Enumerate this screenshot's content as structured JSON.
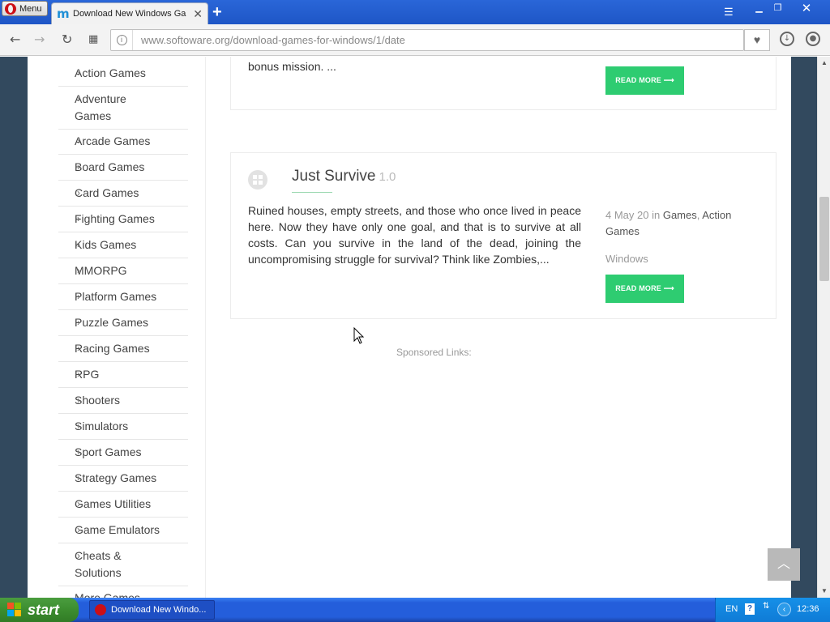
{
  "browser": {
    "menu_label": "Menu",
    "tab_title": "Download New Windows Games",
    "url": "www.softoware.org/download-games-for-windows/1/date"
  },
  "sidebar": {
    "categories": [
      {
        "label": "Action Games"
      },
      {
        "label": "Adventure Games"
      },
      {
        "label": "Arcade Games"
      },
      {
        "label": "Board Games"
      },
      {
        "label": "Card Games"
      },
      {
        "label": "Fighting Games"
      },
      {
        "label": "Kids Games"
      },
      {
        "label": "MMORPG"
      },
      {
        "label": "Platform Games"
      },
      {
        "label": "Puzzle Games"
      },
      {
        "label": "Racing Games"
      },
      {
        "label": "RPG"
      },
      {
        "label": "Shooters"
      },
      {
        "label": "Simulators"
      },
      {
        "label": "Sport Games"
      },
      {
        "label": "Strategy Games"
      },
      {
        "label": "Games Utilities"
      },
      {
        "label": "Game Emulators"
      },
      {
        "label": "Cheats & Solutions"
      },
      {
        "label": "More Games"
      }
    ]
  },
  "previous_card": {
    "excerpt": "bonus mission. ...",
    "read_more": "READ MORE ⟶"
  },
  "game_card": {
    "title": "Just Survive",
    "version": "1.0",
    "description": "Ruined houses, empty streets, and those who once lived in peace here. Now they have only one goal, and that is to survive at all costs. Can you survive in the land of the dead, joining the uncompromising struggle for survival? Think like Zombies,...",
    "date_prefix": "4 May 20 in ",
    "category_1": "Games",
    "category_sep": ", ",
    "category_2": "Action Games",
    "platform": "Windows",
    "read_more": "READ MORE ⟶"
  },
  "sponsored_label": "Sponsored Links:",
  "taskbar": {
    "start_label": "start",
    "task_label": "Download New Windo...",
    "lang": "EN",
    "time": "12:36"
  },
  "colors": {
    "accent_green": "#2ecc71",
    "page_side_bg": "#32495e",
    "title_bar": "#1e56c6"
  }
}
